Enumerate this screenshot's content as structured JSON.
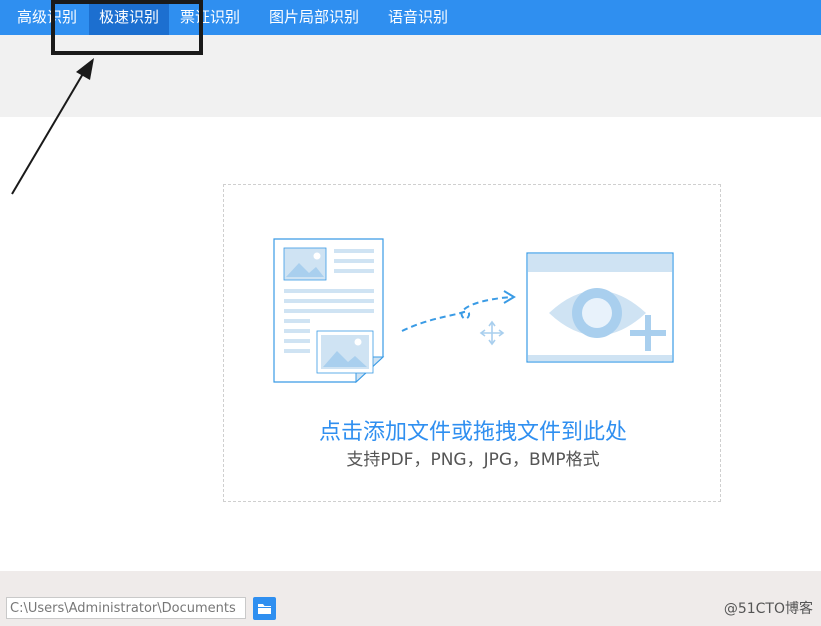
{
  "tabs": [
    {
      "label": "高级识别"
    },
    {
      "label": "极速识别"
    },
    {
      "label": "票证识别"
    },
    {
      "label": "图片局部识别"
    },
    {
      "label": "语音识别"
    }
  ],
  "active_tab": "极速识别",
  "drop_zone": {
    "title": "点击添加文件或拖拽文件到此处",
    "subtitle": "支持PDF，PNG，JPG，BMP格式"
  },
  "footer": {
    "path_value": "C:\\Users\\Administrator\\Documents",
    "watermark": "@51CTO博客"
  },
  "colors": {
    "accent": "#2f8ff0",
    "tab_active": "#1c6fd0",
    "illustration_light": "#cfe3f3"
  },
  "icons": [
    "document-image-icon",
    "dashed-arrow-icon",
    "move-icon",
    "eye-window-icon",
    "plus-icon",
    "folder-icon"
  ]
}
